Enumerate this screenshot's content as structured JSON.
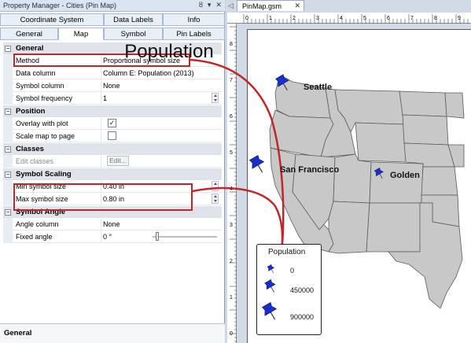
{
  "panel": {
    "title": "Property Manager - Cities (Pin Map)",
    "title_buttons": [
      "ȣ",
      "▾",
      "✕"
    ],
    "tabs_row1": [
      "Coordinate System",
      "Data Labels",
      "Info"
    ],
    "tabs_row2": [
      "General",
      "Map",
      "Symbol",
      "Pin Labels"
    ],
    "active_tab": "Map",
    "categories": {
      "general": "General",
      "position": "Position",
      "classes": "Classes",
      "symbol_scaling": "Symbol Scaling",
      "symbol_angle": "Symbol Angle"
    },
    "rows": {
      "method": {
        "label": "Method",
        "value": "Proportional symbol size"
      },
      "data_column": {
        "label": "Data column",
        "value": "Column E: Population (2013)"
      },
      "symbol_column": {
        "label": "Symbol column",
        "value": "None"
      },
      "symbol_frequency": {
        "label": "Symbol frequency",
        "value": "1"
      },
      "overlay_with_plot": {
        "label": "Overlay with plot",
        "checked": true
      },
      "scale_map_to_page": {
        "label": "Scale map to page",
        "checked": false
      },
      "edit_classes": {
        "label": "Edit classes",
        "button": "Edit..."
      },
      "min_symbol_size": {
        "label": "Min symbol size",
        "value": "0.40 in"
      },
      "max_symbol_size": {
        "label": "Max symbol size",
        "value": "0.80 in"
      },
      "angle_column": {
        "label": "Angle column",
        "value": "None"
      },
      "fixed_angle": {
        "label": "Fixed angle",
        "value": "0 °"
      }
    },
    "footer": "General"
  },
  "document": {
    "tab_label": "PinMap.gsm",
    "ruler_top_labels": [
      "0",
      "1",
      "2",
      "3",
      "4",
      "5",
      "6",
      "7",
      "8",
      "9"
    ],
    "ruler_left_labels": [
      "8",
      "7",
      "6",
      "5",
      "4",
      "3",
      "2",
      "1",
      "0"
    ],
    "map": {
      "title": "Population",
      "cities": [
        "Seattle",
        "San Francisco",
        "Golden"
      ],
      "legend": {
        "title": "Population",
        "entries": [
          "0",
          "450000",
          "900000"
        ]
      }
    }
  },
  "colors": {
    "highlight": "#c0262a",
    "pin": "#1a2fc9",
    "state_fill": "#c8c8c8",
    "state_stroke": "#5a5a5a"
  }
}
